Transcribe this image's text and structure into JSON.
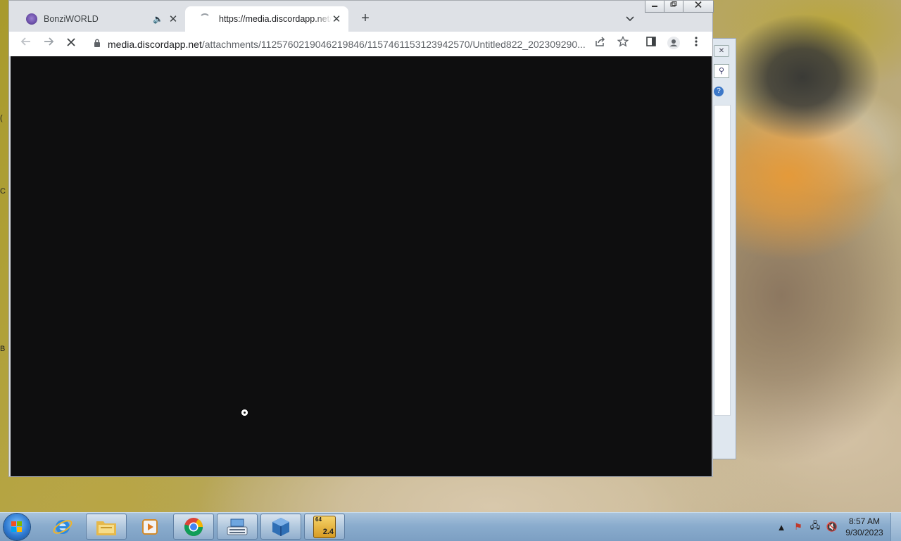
{
  "browser": {
    "tabs": [
      {
        "title": "BonziWORLD",
        "active": false,
        "audio": true
      },
      {
        "title": "https://media.discordapp.net/attachments/1125760219046219846/1157461153123942570/Untitled822_202309290...",
        "active": true,
        "loading": true
      }
    ],
    "new_tab_symbol": "+",
    "tab_search_symbol": "⌄",
    "window_controls": {
      "minimize": "▭",
      "restore": "⧉",
      "close": "✕"
    },
    "nav": {
      "back": "←",
      "forward": "→",
      "stop": "✕"
    },
    "address": {
      "host": "media.discordapp.net",
      "path": "/attachments/1125760219046219846/1157461153123942570/Untitled822_202309290...",
      "secure": true
    },
    "toolbar_icons": [
      "share-icon",
      "bookmark-star-icon",
      "side-panel-icon",
      "profile-icon",
      "menu-icon"
    ],
    "content_background": "#0e0e0f"
  },
  "desktop": {
    "left_edge_fragments": [
      "(",
      "C",
      "B"
    ]
  },
  "taskbar": {
    "pinned": [
      "internet-explorer",
      "file-explorer",
      "media-center",
      "chrome",
      "on-screen-keyboard",
      "virtualbox",
      "game-64-2.4"
    ],
    "app_badge": {
      "top": "64",
      "bottom": "2.4"
    },
    "clock": {
      "time": "8:57 AM",
      "date": "9/30/2023"
    }
  }
}
